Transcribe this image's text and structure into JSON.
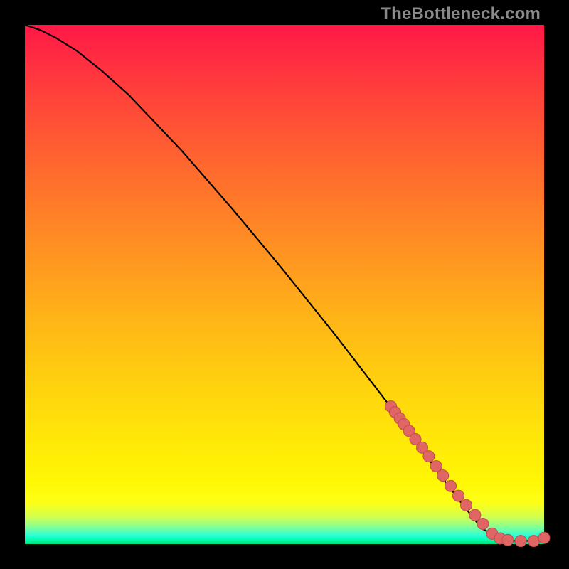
{
  "watermark": "TheBottleneck.com",
  "colors": {
    "curve": "#000000",
    "marker_fill": "#e06666",
    "marker_stroke": "#c24b4b",
    "background_top": "#ff1846",
    "background_bottom": "#00d877"
  },
  "chart_data": {
    "type": "line",
    "title": "",
    "xlabel": "",
    "ylabel": "",
    "xlim": [
      0,
      100
    ],
    "ylim": [
      0,
      100
    ],
    "grid": false,
    "curve": {
      "x": [
        0,
        3,
        6,
        10,
        15,
        20,
        30,
        40,
        50,
        60,
        70,
        78,
        84,
        88,
        92,
        96,
        100
      ],
      "y": [
        100,
        99,
        97.5,
        95,
        91,
        86.5,
        76,
        64.5,
        52.5,
        40,
        27,
        16,
        8,
        3,
        0.8,
        0.5,
        1.2
      ]
    },
    "markers": {
      "x": [
        70.5,
        71.3,
        72.2,
        73.0,
        74.0,
        75.2,
        76.5,
        77.8,
        79.2,
        80.5,
        82.0,
        83.5,
        85.0,
        86.7,
        88.2,
        90.0,
        91.5,
        93.0,
        95.5,
        98.0,
        100.0
      ],
      "y": [
        26.5,
        25.4,
        24.2,
        23.1,
        21.8,
        20.2,
        18.6,
        16.9,
        15.0,
        13.2,
        11.2,
        9.3,
        7.5,
        5.6,
        3.9,
        2.0,
        1.1,
        0.8,
        0.6,
        0.6,
        1.2
      ]
    }
  }
}
